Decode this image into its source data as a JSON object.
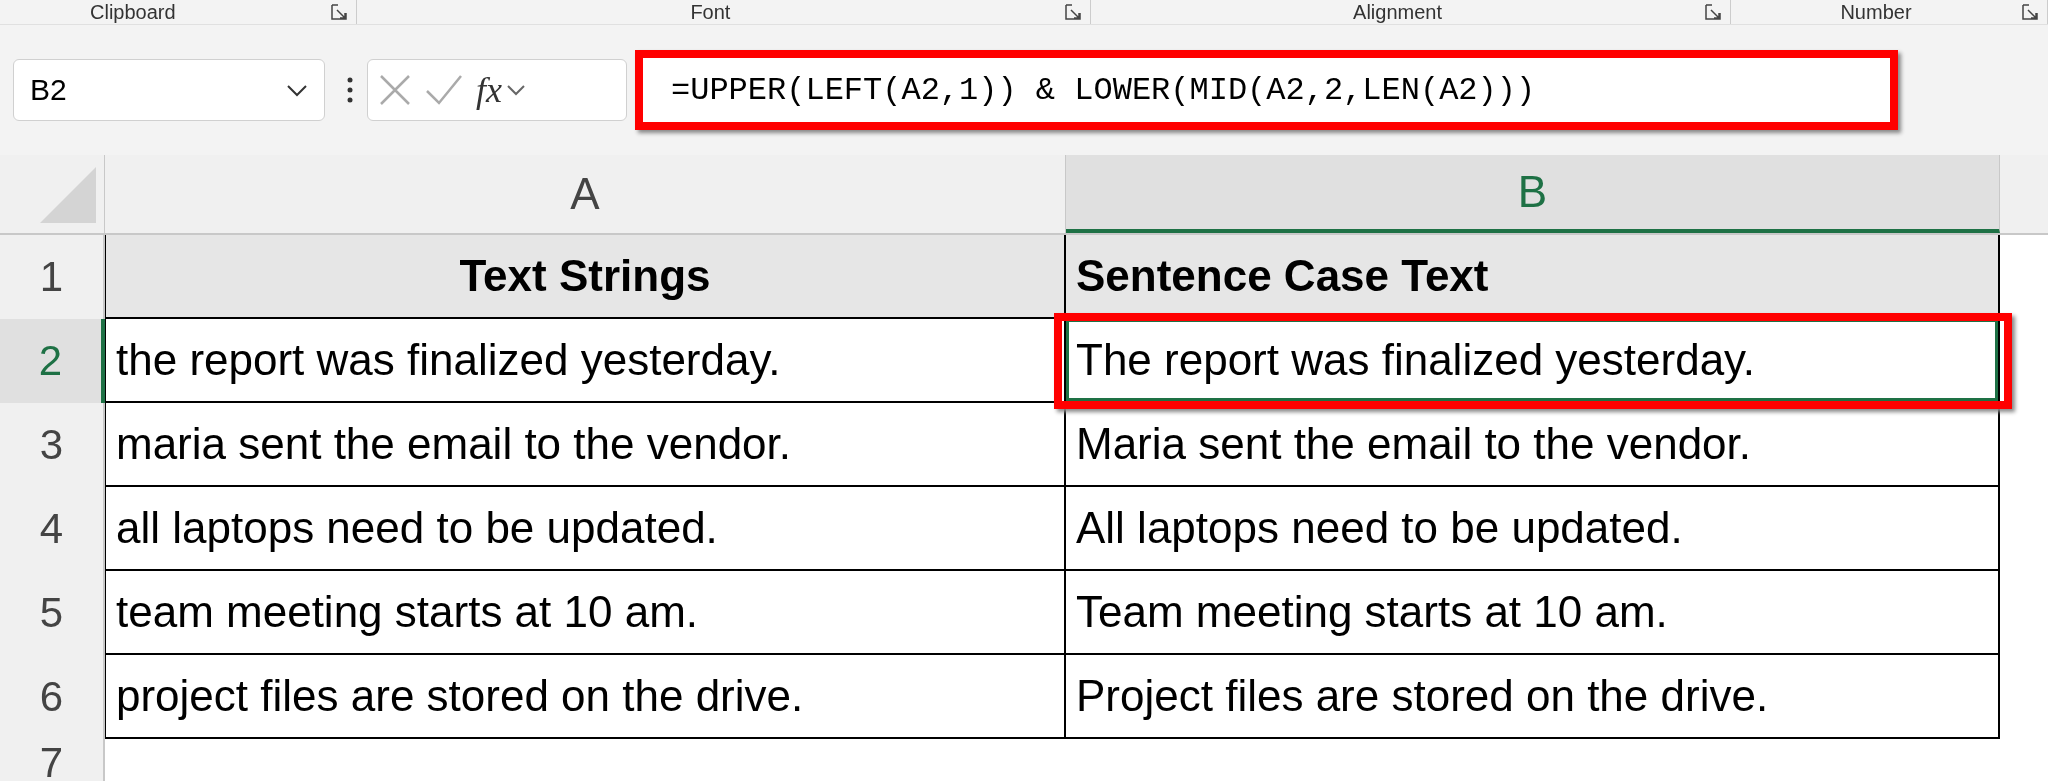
{
  "ribbon_groups": [
    {
      "label": "Clipboard"
    },
    {
      "label": "Font"
    },
    {
      "label": "Alignment"
    },
    {
      "label": "Number"
    }
  ],
  "formula_bar": {
    "name_box": "B2",
    "function_label": "fx",
    "formula": "=UPPER(LEFT(A2,1)) & LOWER(MID(A2,2,LEN(A2)))",
    "highlighted": true
  },
  "columns": [
    {
      "label": "A",
      "selected": false
    },
    {
      "label": "B",
      "selected": true
    }
  ],
  "rows": [
    {
      "number": "1",
      "kind": "header",
      "selected": false,
      "cells": [
        {
          "text": "Text Strings",
          "selected": false,
          "highlighted": false
        },
        {
          "text": "Sentence Case Text",
          "selected": false,
          "highlighted": false
        }
      ]
    },
    {
      "number": "2",
      "kind": "data",
      "selected": true,
      "cells": [
        {
          "text": "the report was finalized yesterday.",
          "selected": false,
          "highlighted": false
        },
        {
          "text": "The report was finalized yesterday.",
          "selected": true,
          "highlighted": true
        }
      ]
    },
    {
      "number": "3",
      "kind": "data",
      "selected": false,
      "cells": [
        {
          "text": "maria sent the email to the vendor.",
          "selected": false,
          "highlighted": false
        },
        {
          "text": "Maria sent the email to the vendor.",
          "selected": false,
          "highlighted": false
        }
      ]
    },
    {
      "number": "4",
      "kind": "data",
      "selected": false,
      "cells": [
        {
          "text": "all laptops need to be updated.",
          "selected": false,
          "highlighted": false
        },
        {
          "text": "All laptops need to be updated.",
          "selected": false,
          "highlighted": false
        }
      ]
    },
    {
      "number": "5",
      "kind": "data",
      "selected": false,
      "cells": [
        {
          "text": "team meeting starts at 10 am.",
          "selected": false,
          "highlighted": false
        },
        {
          "text": "Team meeting starts at 10 am.",
          "selected": false,
          "highlighted": false
        }
      ]
    },
    {
      "number": "6",
      "kind": "data",
      "selected": false,
      "cells": [
        {
          "text": "project files are stored on the drive.",
          "selected": false,
          "highlighted": false
        },
        {
          "text": "Project files are stored on the drive.",
          "selected": false,
          "highlighted": false
        }
      ]
    },
    {
      "number": "7",
      "kind": "empty",
      "selected": false,
      "cells": []
    }
  ]
}
